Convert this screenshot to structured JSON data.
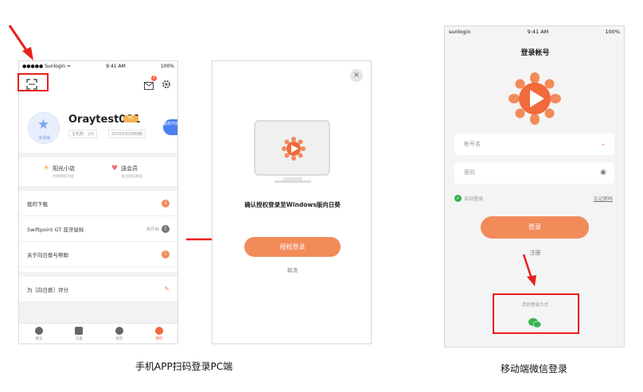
{
  "left_phone": {
    "status": {
      "carrier": "●●●●● Sunlogin ≈",
      "time": "9:41 AM",
      "battery": "100%"
    },
    "username": "Oraytest001",
    "pc_tag": "PC",
    "avatar_label": "免费版",
    "meta_hosts": "主机数：2/5",
    "meta_date": "2016/08/08到期",
    "service_tab": "服务开启",
    "message_badge": "2",
    "shop": [
      {
        "icon": "sun-icon",
        "title": "阳光小店",
        "sub": "兑换特权功能"
      },
      {
        "icon": "heart-icon",
        "title": "送会员",
        "sub": "关注微信赠送"
      }
    ],
    "list": [
      {
        "label": "我的下载",
        "right": "",
        "icon": "download-icon"
      },
      {
        "label": "Swiftpoint GT 蓝牙鼠标",
        "right": "未开启",
        "icon": "bluetooth-icon"
      },
      {
        "label": "关于向日葵与帮助",
        "right": "",
        "icon": "info-icon"
      },
      {
        "label": "为［向日葵］评分",
        "right": "",
        "icon": "edit-icon"
      }
    ],
    "tabs": [
      "概览",
      "设备",
      "发现",
      "我的"
    ]
  },
  "dialog": {
    "close": "×",
    "confirm_text": "确认授权登录至Windows版向日葵",
    "auth_button": "授权登录",
    "cancel": "取消"
  },
  "right_phone": {
    "status": {
      "carrier": "sunlogin",
      "time": "9:41 AM",
      "battery": "100%"
    },
    "title": "登录帐号",
    "account_placeholder": "帐号名",
    "password_placeholder": "密码",
    "auto_login": "自动登录",
    "forgot": "忘记密码",
    "login_button": "登录",
    "register": "注册",
    "other_login": "其他登录方式"
  },
  "captions": {
    "left": "手机APP扫码登录PC端",
    "right": "移动端微信登录"
  },
  "colors": {
    "accent": "#f28b5a",
    "annotation": "#e8201c",
    "wechat": "#36b34d"
  }
}
